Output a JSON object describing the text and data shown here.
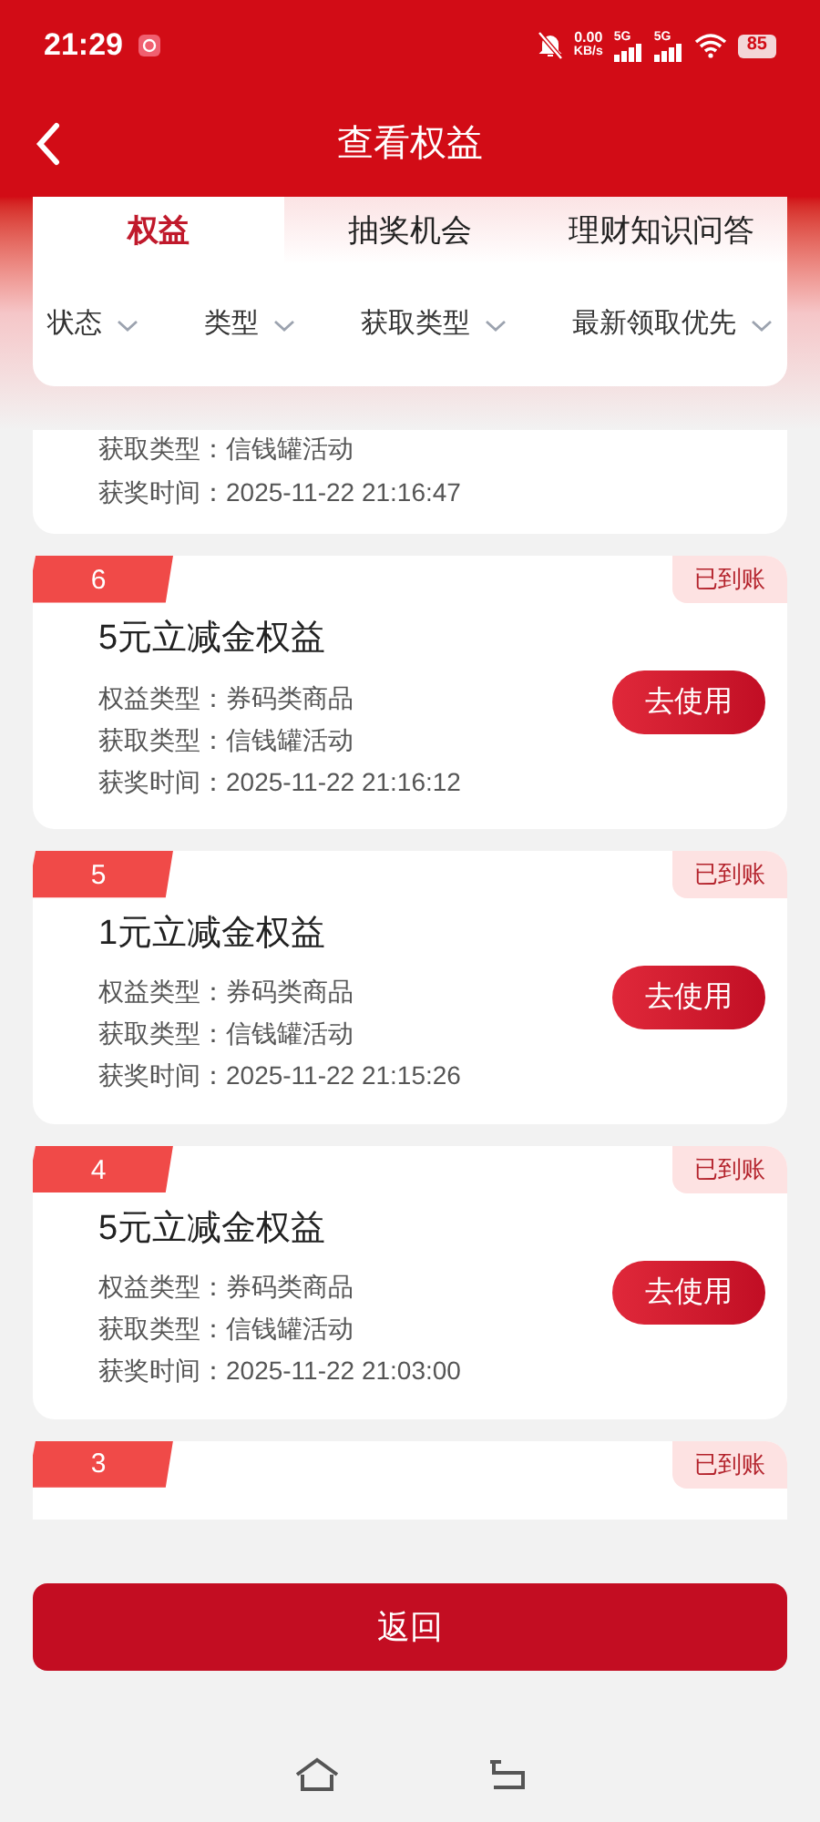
{
  "status_bar": {
    "time": "21:29",
    "net_speed": "0.00",
    "net_unit": "KB/s",
    "signal_1": "5G",
    "signal_2": "5G",
    "battery": "85"
  },
  "header": {
    "title": "查看权益"
  },
  "tabs": [
    {
      "label": "权益",
      "selected": true
    },
    {
      "label": "抽奖机会",
      "selected": false
    },
    {
      "label": "理财知识问答",
      "selected": false
    }
  ],
  "filters": [
    {
      "label": "状态"
    },
    {
      "label": "类型"
    },
    {
      "label": "获取类型"
    },
    {
      "label": "最新领取优先"
    }
  ],
  "cards": [
    {
      "kind": "partial-top",
      "lines": [
        "获取类型：信钱罐活动",
        "获奖时间：2025-11-22 21:16:47"
      ]
    },
    {
      "kind": "full",
      "index": "6",
      "status": "已到账",
      "title": "5元立减金权益",
      "lines": [
        "权益类型：券码类商品",
        "获取类型：信钱罐活动",
        "获奖时间：2025-11-22 21:16:12"
      ],
      "action": "去使用"
    },
    {
      "kind": "full",
      "index": "5",
      "status": "已到账",
      "title": "1元立减金权益",
      "lines": [
        "权益类型：券码类商品",
        "获取类型：信钱罐活动",
        "获奖时间：2025-11-22 21:15:26"
      ],
      "action": "去使用"
    },
    {
      "kind": "full",
      "index": "4",
      "status": "已到账",
      "title": "5元立减金权益",
      "lines": [
        "权益类型：券码类商品",
        "获取类型：信钱罐活动",
        "获奖时间：2025-11-22 21:03:00"
      ],
      "action": "去使用"
    },
    {
      "kind": "partial-bottom",
      "index": "3",
      "status": "已到账"
    }
  ],
  "footer_button": "返回"
}
